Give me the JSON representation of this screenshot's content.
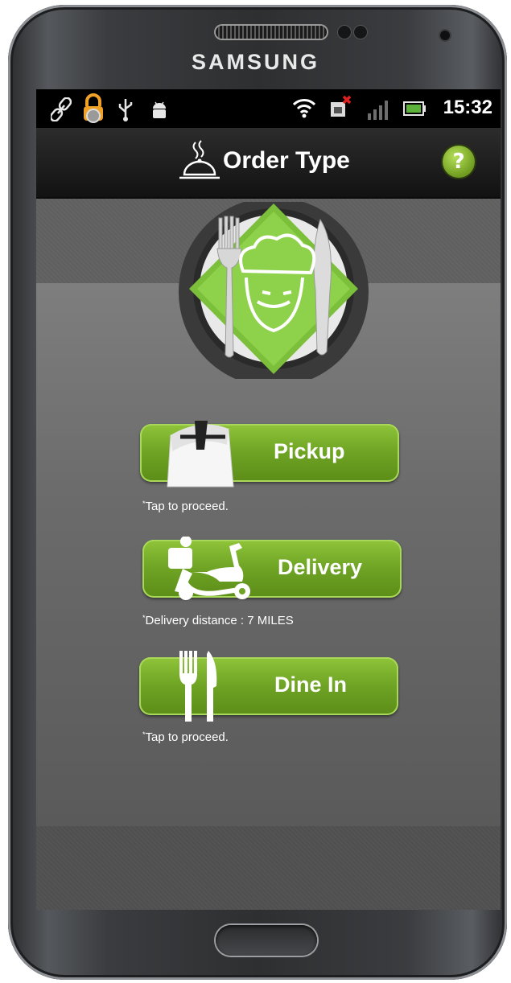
{
  "device": {
    "brand": "SAMSUNG"
  },
  "statusbar": {
    "time": "15:32",
    "icons": [
      "link-icon",
      "lock-icon",
      "usb-icon",
      "android-icon",
      "wifi-icon",
      "no-sim-icon",
      "signal-icon",
      "battery-icon"
    ]
  },
  "header": {
    "title": "Order Type",
    "help_symbol": "?"
  },
  "order_options": [
    {
      "label": "Pickup",
      "hint": "Tap to proceed.",
      "icon": "bag-icon"
    },
    {
      "label": "Delivery",
      "hint": "Delivery distance : 7 MILES",
      "icon": "scooter-icon"
    },
    {
      "label": "Dine In",
      "hint": "Tap to proceed.",
      "icon": "fork-knife-icon"
    }
  ],
  "colors": {
    "accent_green": "#6ea324",
    "titlebar": "#1e1e1e",
    "background": "#6b6b6b"
  }
}
